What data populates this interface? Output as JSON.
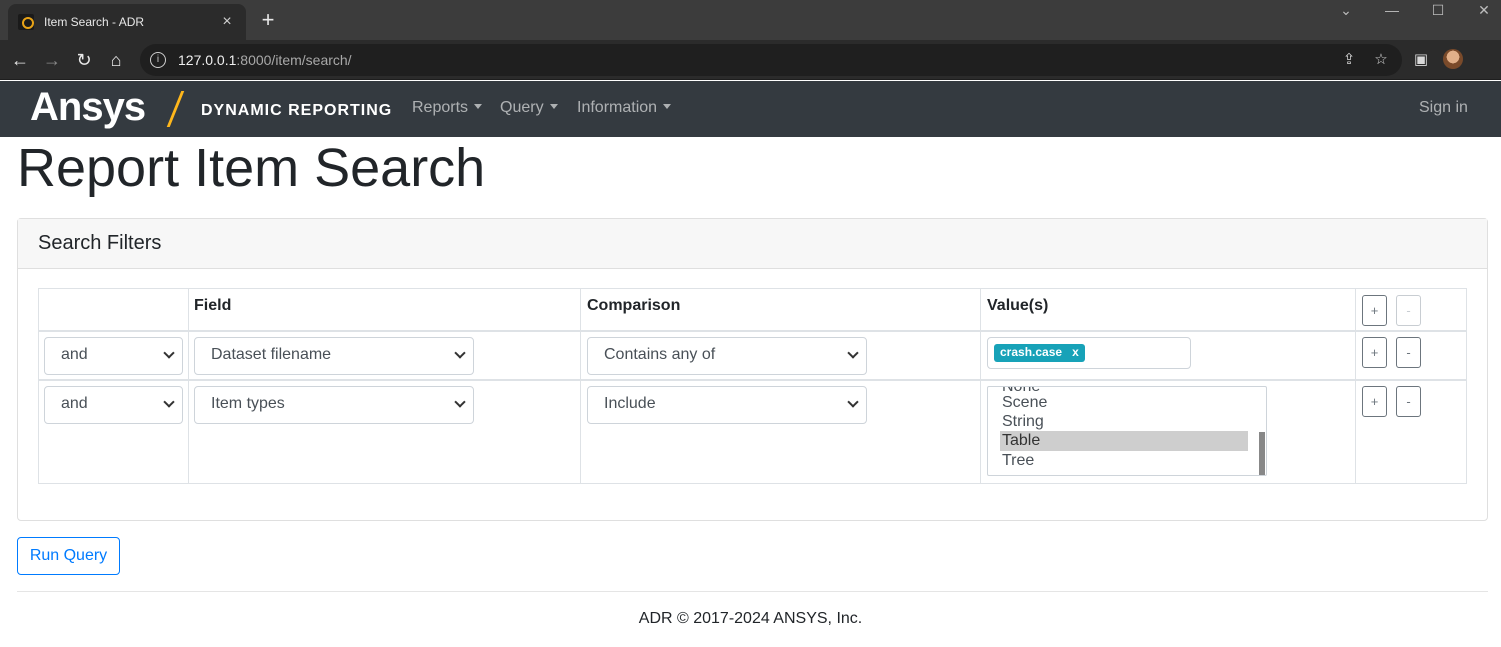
{
  "browser": {
    "tab_title": "Item Search - ADR",
    "tab_close": "×",
    "new_tab": "+",
    "url_host": "127.0.0.1",
    "url_path": ":8000/item/search/",
    "win_minimize": "—",
    "win_maximize": "☐",
    "win_close": "✕",
    "win_dropdown": "⌄"
  },
  "navbar": {
    "brand": "Ansys",
    "brand_sub": "DYNAMIC REPORTING",
    "menus": [
      "Reports",
      "Query",
      "Information"
    ],
    "sign_in": "Sign in"
  },
  "page": {
    "title": "Report Item Search"
  },
  "filters": {
    "header": "Search Filters",
    "columns": {
      "field": "Field",
      "comparison": "Comparison",
      "values": "Value(s)"
    },
    "add_label": "+",
    "remove_label": "-",
    "rows": [
      {
        "logic": "and",
        "field": "Dataset filename",
        "comparison": "Contains any of",
        "tag": "crash.case",
        "tag_remove": "x"
      },
      {
        "logic": "and",
        "field": "Item types",
        "comparison": "Include",
        "options": [
          "None",
          "Scene",
          "String",
          "Table",
          "Tree"
        ],
        "selected": "Table"
      }
    ]
  },
  "actions": {
    "run_query": "Run Query"
  },
  "footer": {
    "text": "ADR © 2017-2024 ANSYS, Inc."
  },
  "colors": {
    "navbar": "#343a40",
    "brand_accent": "#ffb71b",
    "primary": "#007bff",
    "tag": "#17a2b8"
  }
}
